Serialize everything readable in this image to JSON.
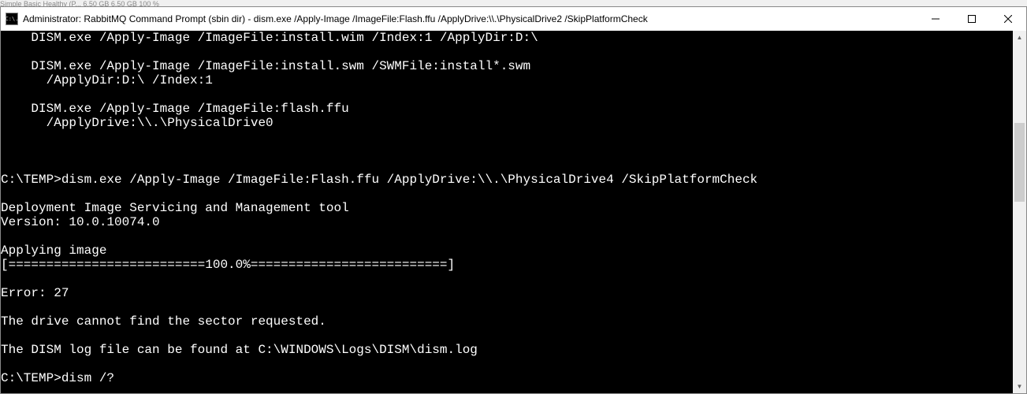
{
  "titlebar": {
    "icon_text": "C:\\.",
    "title": "Administrator: RabbitMQ Command Prompt (sbin dir) - dism.exe  /Apply-Image /ImageFile:Flash.ffu /ApplyDrive:\\\\.\\PhysicalDrive2 /SkipPlatformCheck"
  },
  "terminal": {
    "lines": [
      "    DISM.exe /Apply-Image /ImageFile:install.wim /Index:1 /ApplyDir:D:\\",
      "",
      "    DISM.exe /Apply-Image /ImageFile:install.swm /SWMFile:install*.swm",
      "      /ApplyDir:D:\\ /Index:1",
      "",
      "    DISM.exe /Apply-Image /ImageFile:flash.ffu",
      "      /ApplyDrive:\\\\.\\PhysicalDrive0",
      "",
      "",
      "",
      "C:\\TEMP>dism.exe /Apply-Image /ImageFile:Flash.ffu /ApplyDrive:\\\\.\\PhysicalDrive4 /SkipPlatformCheck",
      "",
      "Deployment Image Servicing and Management tool",
      "Version: 10.0.10074.0",
      "",
      "Applying image",
      "[==========================100.0%==========================]",
      "",
      "Error: 27",
      "",
      "The drive cannot find the sector requested.",
      "",
      "The DISM log file can be found at C:\\WINDOWS\\Logs\\DISM\\dism.log",
      "",
      "C:\\TEMP>dism /?"
    ]
  },
  "background_hint": "Simple   Basic          Healthy (P...  6.50 GB    6.50 GB    100 %"
}
